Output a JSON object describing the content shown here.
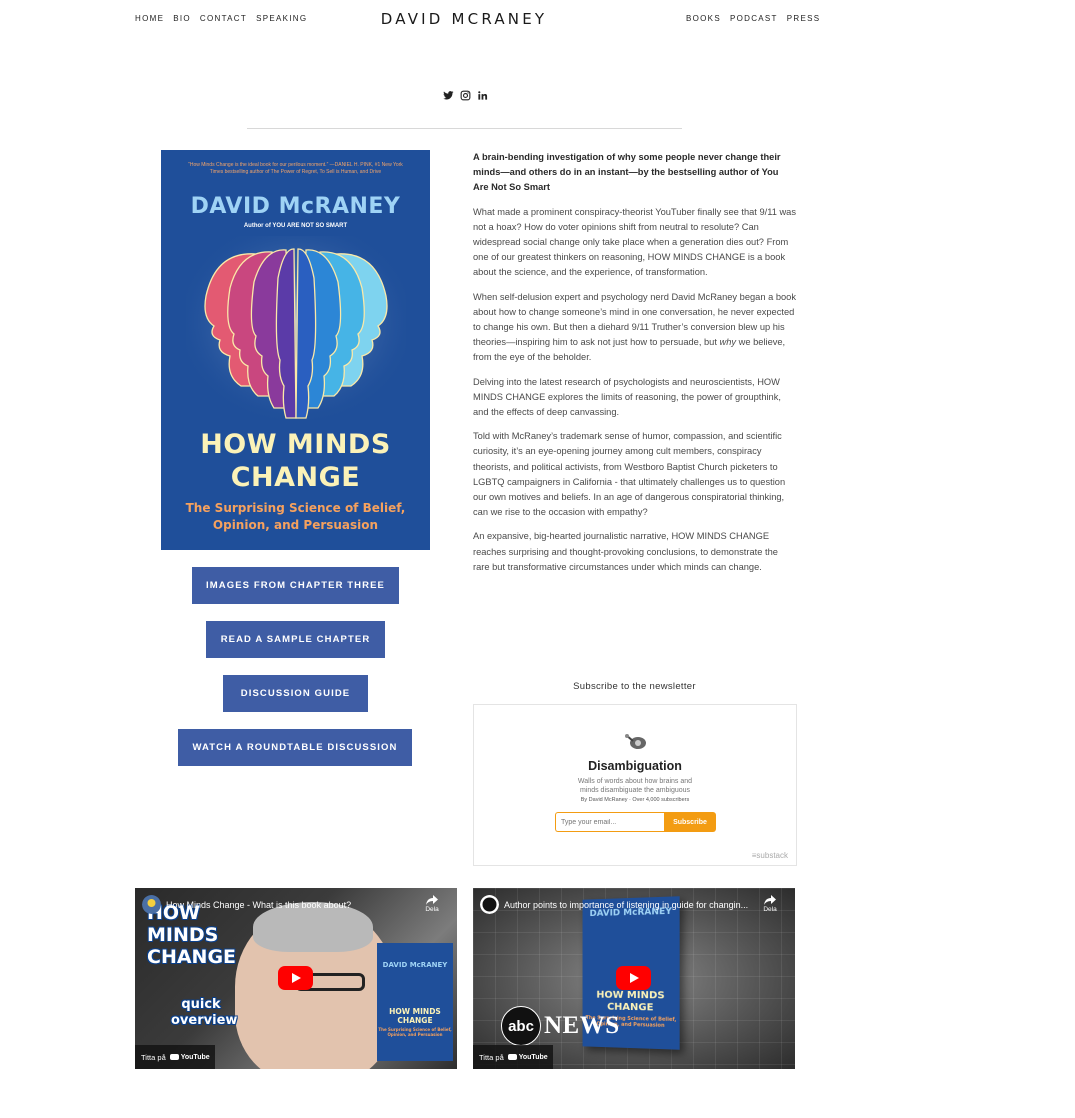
{
  "header": {
    "site_title": "DAVID MCRANEY",
    "nav_left": [
      "HOME",
      "BIO",
      "CONTACT",
      "SPEAKING"
    ],
    "nav_right": [
      "BOOKS",
      "PODCAST",
      "PRESS"
    ]
  },
  "social": [
    "twitter-icon",
    "instagram-icon",
    "linkedin-icon"
  ],
  "cover": {
    "quote": "“How Minds Change is the ideal book for our perilous moment.” —DANIEL H. PINK, #1 New York Times bestselling author of The Power of Regret, To Sell is Human, and Drive",
    "author": "DAVID McRANEY",
    "author_sub": "Author of YOU ARE NOT SO SMART",
    "title_line1": "HOW MINDS",
    "title_line2": "CHANGE",
    "subtitle_line1": "The Surprising Science of Belief,",
    "subtitle_line2": "Opinion, and Persuasion"
  },
  "buttons": {
    "images": "IMAGES FROM CHAPTER THREE",
    "sample": "READ A SAMPLE CHAPTER",
    "guide": "DISCUSSION GUIDE",
    "roundtable": "WATCH A ROUNDTABLE DISCUSSION"
  },
  "description": {
    "lead": "A brain-bending investigation of why some people never change their minds—and others do in an instant—by the bestselling author of You Are Not So Smart",
    "p1": "What made a prominent conspiracy-theorist YouTuber finally see that 9/11 was not a hoax? How do voter opinions shift from neutral to resolute? Can widespread social change only take place when a generation dies out? From one of our greatest thinkers on reasoning, HOW MINDS CHANGE is a book about the science, and the experience, of transformation.",
    "p2_a": "When self-delusion expert and psychology nerd David McRaney began a book about how to change someone’s mind in one conversation, he never expected to change his own. But then a diehard 9/11 Truther’s conversion blew up his theories—inspiring him to ask not just how to persuade, but ",
    "p2_em": "why",
    "p2_b": " we believe, from the eye of the beholder.",
    "p3": "Delving into the latest research of psychologists and neuroscientists, HOW MINDS CHANGE explores the limits of reasoning, the power of groupthink, and the effects of deep canvassing.",
    "p4": "Told with McRaney’s trademark sense of humor, compassion, and scientific curiosity, it’s an eye-opening journey among cult members, conspiracy theorists, and political activists, from Westboro Baptist Church picketers to LGBTQ campaigners in California - that ultimately challenges us to question our own motives and beliefs. In an age of dangerous conspiratorial thinking, can we rise to the occasion with empathy?",
    "p5": "An expansive, big-hearted journalistic narrative, HOW MINDS CHANGE reaches surprising and thought-provoking conclusions, to demonstrate the rare but transformative circumstances under which minds can change."
  },
  "newsletter": {
    "label": "Subscribe to the newsletter",
    "name": "Disambiguation",
    "tagline": "Walls of words about how brains and minds disambiguate the ambiguous",
    "byline": "By David McRaney · Over 4,000 subscribers",
    "placeholder": "Type your email...",
    "button": "Subscribe",
    "brand": "substack"
  },
  "videos": [
    {
      "title": "How Minds Change - What is this book about?",
      "share": "Dela",
      "watch": "Titta på",
      "yt": "YouTube",
      "overlay_big": "HOW MINDS CHANGE",
      "overlay_quick": "quick overview",
      "book_author": "DAVID McRANEY",
      "book_title": "HOW MINDS CHANGE",
      "book_sub": "The Surprising Science of Belief, Opinion, and Persuasion"
    },
    {
      "title": "Author points to importance of listening in guide for changin...",
      "share": "Dela",
      "watch": "Titta på",
      "yt": "YouTube",
      "abc": "abc",
      "news": "NEWS",
      "book_author": "DAVID McRANEY",
      "book_title": "HOW MINDS CHANGE",
      "book_sub": "The Surprising Science of Belief, Opinion, and Persuasion"
    }
  ],
  "colors": {
    "button_bg": "#3f5da5",
    "cover_bg": "#1f4f9a",
    "substack_accent": "#f39c12",
    "youtube_red": "#ff0000"
  }
}
